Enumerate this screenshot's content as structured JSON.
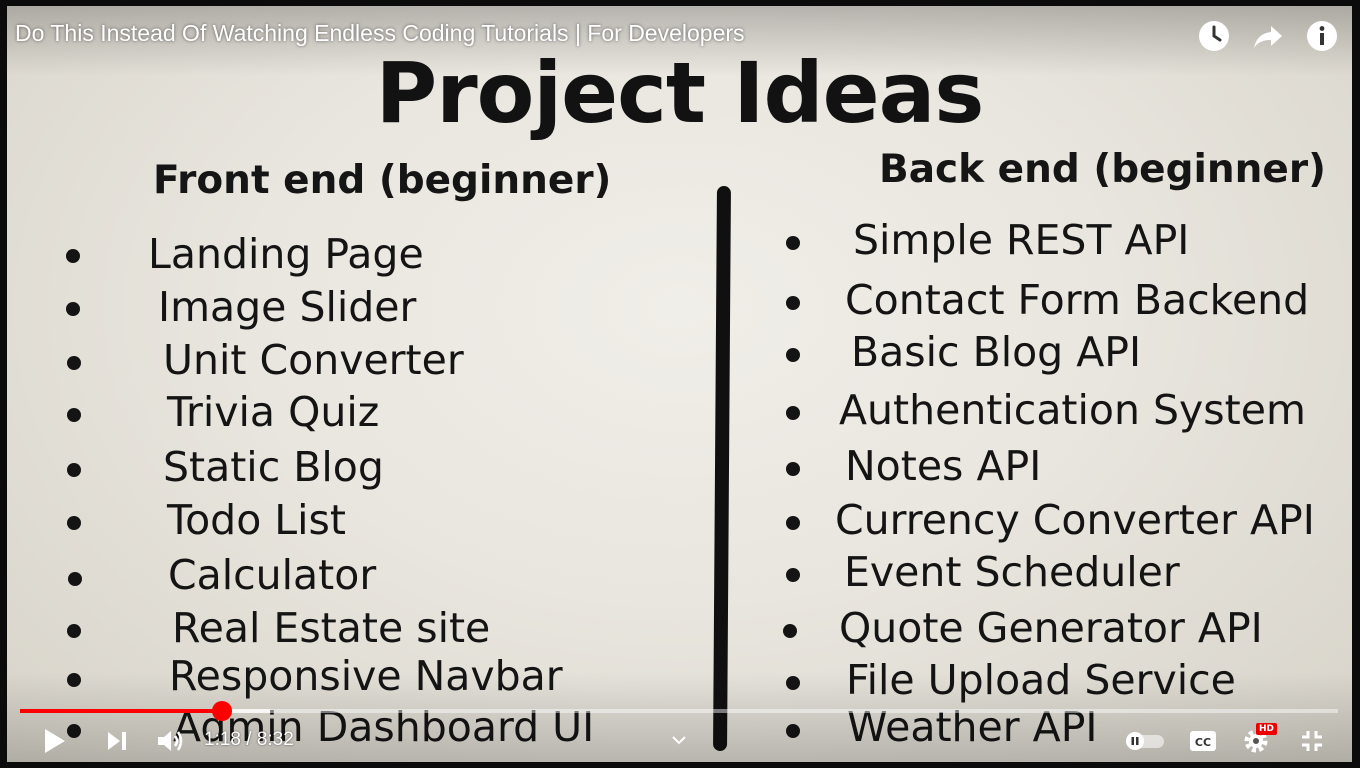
{
  "player": {
    "video_title": "Do This Instead Of Watching Endless Coding Tutorials | For Developers",
    "current_time": "1:18",
    "duration": "8:32",
    "time_display": "1:18 / 8:32",
    "progress_fraction": 0.153,
    "buffered_fraction": 0.19,
    "hd_badge": "HD",
    "icons": {
      "watch_later": "clock-icon",
      "share": "share-arrow-icon",
      "info": "info-icon",
      "play": "play-icon",
      "next": "skip-next-icon",
      "volume": "volume-icon",
      "chapters": "chevron-down-icon",
      "autoplay": "autoplay-toggle-icon",
      "captions": "cc-icon",
      "settings": "gear-icon",
      "fullscreen": "fullscreen-icon"
    },
    "accent_color": "#ff0000"
  },
  "slide": {
    "heading": "Project Ideas",
    "left_title": "Front end (beginner)",
    "right_title": "Back end (beginner)",
    "left_items": [
      "Landing Page",
      "Image Slider",
      "Unit Converter",
      "Trivia Quiz",
      "Static Blog",
      "Todo List",
      "Calculator",
      "Real Estate site",
      "Responsive Navbar",
      "Admin Dashboard UI"
    ],
    "right_items": [
      "Simple REST API",
      "Contact Form Backend",
      "Basic Blog API",
      "Authentication  System",
      "Notes API",
      "Currency Converter API",
      "Event Scheduler",
      "Quote Generator API",
      "File Upload Service",
      "Weather  API"
    ]
  }
}
